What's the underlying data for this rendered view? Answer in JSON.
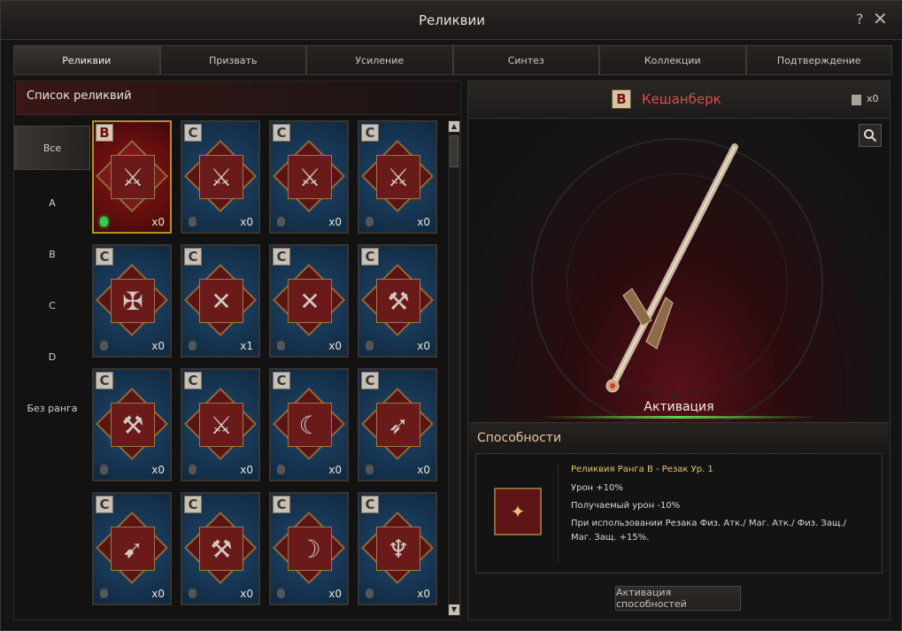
{
  "window": {
    "title": "Реликвии"
  },
  "tabs": [
    "Реликвии",
    "Призвать",
    "Усиление",
    "Синтез",
    "Коллекции",
    "Подтверждение"
  ],
  "list": {
    "title": "Список реликвий",
    "filters": [
      "Все",
      "A",
      "B",
      "C",
      "D",
      "Без ранга"
    ],
    "cards": [
      {
        "rank": "B",
        "count": "x0",
        "icon": "daggers-icon",
        "glyph": "⚔",
        "stone": "green"
      },
      {
        "rank": "C",
        "count": "x0",
        "icon": "daggers-icon",
        "glyph": "⚔",
        "stone": "grey"
      },
      {
        "rank": "C",
        "count": "x0",
        "icon": "daggers-icon",
        "glyph": "⚔",
        "stone": "grey"
      },
      {
        "rank": "C",
        "count": "x0",
        "icon": "daggers-icon",
        "glyph": "⚔",
        "stone": "grey"
      },
      {
        "rank": "C",
        "count": "x0",
        "icon": "golden-sword-icon",
        "glyph": "✠",
        "stone": "grey"
      },
      {
        "rank": "C",
        "count": "x1",
        "icon": "crossed-swords-icon",
        "glyph": "✕",
        "stone": "grey"
      },
      {
        "rank": "C",
        "count": "x0",
        "icon": "crossed-swords-icon",
        "glyph": "✕",
        "stone": "grey"
      },
      {
        "rank": "C",
        "count": "x0",
        "icon": "hammer-icon",
        "glyph": "⚒",
        "stone": "grey"
      },
      {
        "rank": "C",
        "count": "x0",
        "icon": "battle-axe-icon",
        "glyph": "⚒",
        "stone": "grey"
      },
      {
        "rank": "C",
        "count": "x0",
        "icon": "halberd-icon",
        "glyph": "⚔",
        "stone": "grey"
      },
      {
        "rank": "C",
        "count": "x0",
        "icon": "scythe-icon",
        "glyph": "☾",
        "stone": "grey"
      },
      {
        "rank": "C",
        "count": "x0",
        "icon": "spear-icon",
        "glyph": "➶",
        "stone": "grey"
      },
      {
        "rank": "C",
        "count": "x0",
        "icon": "bow-icon",
        "glyph": "➹",
        "stone": "grey"
      },
      {
        "rank": "C",
        "count": "x0",
        "icon": "axe-icon",
        "glyph": "⚒",
        "stone": "grey"
      },
      {
        "rank": "C",
        "count": "x0",
        "icon": "curved-blade-icon",
        "glyph": "☽",
        "stone": "grey"
      },
      {
        "rank": "C",
        "count": "x0",
        "icon": "trident-icon",
        "glyph": "♆",
        "stone": "grey"
      }
    ]
  },
  "detail": {
    "rank": "B",
    "name": "Кешанберк",
    "card_count": "x0",
    "activation_label": "Активация",
    "ability_title": "Способности",
    "ability_name": "Реликвия Ранга B - Резак Ур. 1",
    "ability_lines": [
      "Урон +10%",
      "Получаемый урон -10%",
      "При использовании Резака Физ. Атк./ Маг. Атк./ Физ. Защ./ Маг. Защ. +15%."
    ],
    "activate_button": "Активация способностей"
  },
  "colors": {
    "accent_red": "#e24a4a",
    "gold": "#e7c56e",
    "active_green": "#4fdc4f"
  }
}
